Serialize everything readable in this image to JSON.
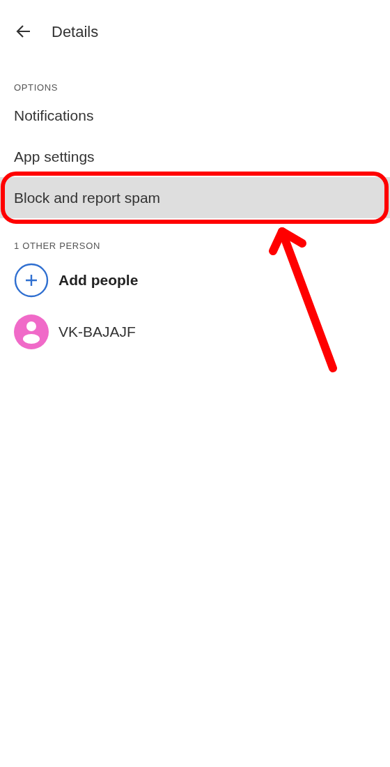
{
  "header": {
    "title": "Details"
  },
  "options": {
    "heading": "OPTIONS",
    "items": [
      {
        "label": "Notifications",
        "selected": false,
        "callout": false
      },
      {
        "label": "App settings",
        "selected": false,
        "callout": false
      },
      {
        "label": "Block and report spam",
        "selected": true,
        "callout": true
      }
    ]
  },
  "people": {
    "heading": "1 OTHER PERSON",
    "items": [
      {
        "kind": "add",
        "label": "Add people"
      },
      {
        "kind": "contact",
        "label": "VK-BAJAJF"
      }
    ]
  }
}
